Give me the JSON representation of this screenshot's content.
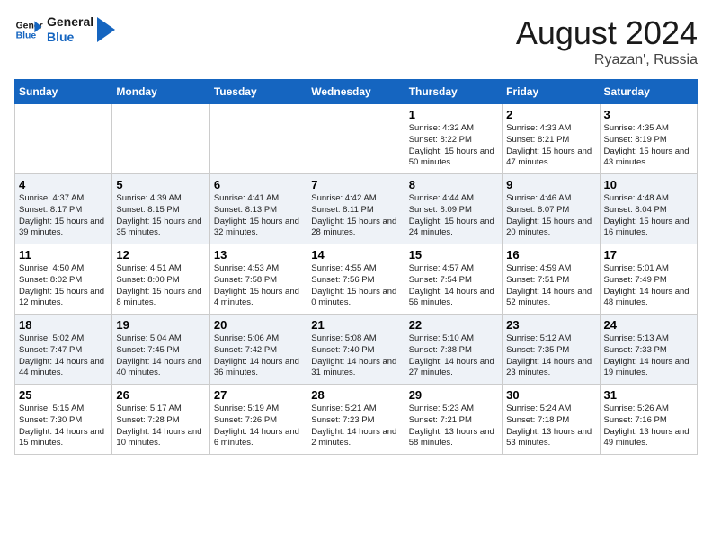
{
  "header": {
    "logo_text_general": "General",
    "logo_text_blue": "Blue",
    "month_year": "August 2024",
    "location": "Ryazan', Russia"
  },
  "weekdays": [
    "Sunday",
    "Monday",
    "Tuesday",
    "Wednesday",
    "Thursday",
    "Friday",
    "Saturday"
  ],
  "weeks": [
    [
      {
        "day": "",
        "content": ""
      },
      {
        "day": "",
        "content": ""
      },
      {
        "day": "",
        "content": ""
      },
      {
        "day": "",
        "content": ""
      },
      {
        "day": "1",
        "content": "Sunrise: 4:32 AM\nSunset: 8:22 PM\nDaylight: 15 hours\nand 50 minutes."
      },
      {
        "day": "2",
        "content": "Sunrise: 4:33 AM\nSunset: 8:21 PM\nDaylight: 15 hours\nand 47 minutes."
      },
      {
        "day": "3",
        "content": "Sunrise: 4:35 AM\nSunset: 8:19 PM\nDaylight: 15 hours\nand 43 minutes."
      }
    ],
    [
      {
        "day": "4",
        "content": "Sunrise: 4:37 AM\nSunset: 8:17 PM\nDaylight: 15 hours\nand 39 minutes."
      },
      {
        "day": "5",
        "content": "Sunrise: 4:39 AM\nSunset: 8:15 PM\nDaylight: 15 hours\nand 35 minutes."
      },
      {
        "day": "6",
        "content": "Sunrise: 4:41 AM\nSunset: 8:13 PM\nDaylight: 15 hours\nand 32 minutes."
      },
      {
        "day": "7",
        "content": "Sunrise: 4:42 AM\nSunset: 8:11 PM\nDaylight: 15 hours\nand 28 minutes."
      },
      {
        "day": "8",
        "content": "Sunrise: 4:44 AM\nSunset: 8:09 PM\nDaylight: 15 hours\nand 24 minutes."
      },
      {
        "day": "9",
        "content": "Sunrise: 4:46 AM\nSunset: 8:07 PM\nDaylight: 15 hours\nand 20 minutes."
      },
      {
        "day": "10",
        "content": "Sunrise: 4:48 AM\nSunset: 8:04 PM\nDaylight: 15 hours\nand 16 minutes."
      }
    ],
    [
      {
        "day": "11",
        "content": "Sunrise: 4:50 AM\nSunset: 8:02 PM\nDaylight: 15 hours\nand 12 minutes."
      },
      {
        "day": "12",
        "content": "Sunrise: 4:51 AM\nSunset: 8:00 PM\nDaylight: 15 hours\nand 8 minutes."
      },
      {
        "day": "13",
        "content": "Sunrise: 4:53 AM\nSunset: 7:58 PM\nDaylight: 15 hours\nand 4 minutes."
      },
      {
        "day": "14",
        "content": "Sunrise: 4:55 AM\nSunset: 7:56 PM\nDaylight: 15 hours\nand 0 minutes."
      },
      {
        "day": "15",
        "content": "Sunrise: 4:57 AM\nSunset: 7:54 PM\nDaylight: 14 hours\nand 56 minutes."
      },
      {
        "day": "16",
        "content": "Sunrise: 4:59 AM\nSunset: 7:51 PM\nDaylight: 14 hours\nand 52 minutes."
      },
      {
        "day": "17",
        "content": "Sunrise: 5:01 AM\nSunset: 7:49 PM\nDaylight: 14 hours\nand 48 minutes."
      }
    ],
    [
      {
        "day": "18",
        "content": "Sunrise: 5:02 AM\nSunset: 7:47 PM\nDaylight: 14 hours\nand 44 minutes."
      },
      {
        "day": "19",
        "content": "Sunrise: 5:04 AM\nSunset: 7:45 PM\nDaylight: 14 hours\nand 40 minutes."
      },
      {
        "day": "20",
        "content": "Sunrise: 5:06 AM\nSunset: 7:42 PM\nDaylight: 14 hours\nand 36 minutes."
      },
      {
        "day": "21",
        "content": "Sunrise: 5:08 AM\nSunset: 7:40 PM\nDaylight: 14 hours\nand 31 minutes."
      },
      {
        "day": "22",
        "content": "Sunrise: 5:10 AM\nSunset: 7:38 PM\nDaylight: 14 hours\nand 27 minutes."
      },
      {
        "day": "23",
        "content": "Sunrise: 5:12 AM\nSunset: 7:35 PM\nDaylight: 14 hours\nand 23 minutes."
      },
      {
        "day": "24",
        "content": "Sunrise: 5:13 AM\nSunset: 7:33 PM\nDaylight: 14 hours\nand 19 minutes."
      }
    ],
    [
      {
        "day": "25",
        "content": "Sunrise: 5:15 AM\nSunset: 7:30 PM\nDaylight: 14 hours\nand 15 minutes."
      },
      {
        "day": "26",
        "content": "Sunrise: 5:17 AM\nSunset: 7:28 PM\nDaylight: 14 hours\nand 10 minutes."
      },
      {
        "day": "27",
        "content": "Sunrise: 5:19 AM\nSunset: 7:26 PM\nDaylight: 14 hours\nand 6 minutes."
      },
      {
        "day": "28",
        "content": "Sunrise: 5:21 AM\nSunset: 7:23 PM\nDaylight: 14 hours\nand 2 minutes."
      },
      {
        "day": "29",
        "content": "Sunrise: 5:23 AM\nSunset: 7:21 PM\nDaylight: 13 hours\nand 58 minutes."
      },
      {
        "day": "30",
        "content": "Sunrise: 5:24 AM\nSunset: 7:18 PM\nDaylight: 13 hours\nand 53 minutes."
      },
      {
        "day": "31",
        "content": "Sunrise: 5:26 AM\nSunset: 7:16 PM\nDaylight: 13 hours\nand 49 minutes."
      }
    ]
  ]
}
